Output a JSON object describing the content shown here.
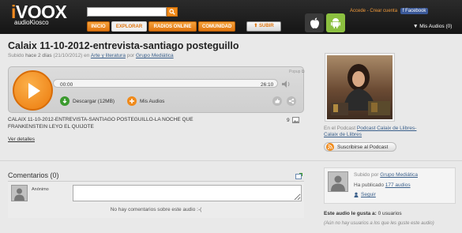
{
  "header": {
    "logo_main": "ivoox",
    "logo_sub": "audioKiosco",
    "search_placeholder": "",
    "nav": [
      "INICIO",
      "EXPLORAR",
      "RADIOS ONLINE",
      "COMUNIDAD"
    ],
    "upload_label": "SUBIR",
    "link_login": "Accede",
    "link_sep": " - ",
    "link_register": "Crear cuenta",
    "facebook_label": "Facebook",
    "mis_audios": "Mis Audios (0)",
    "accent_color": "#f08a1a"
  },
  "episode": {
    "title": "Calaix 11-10-2012-entrevista-santiago posteguillo",
    "meta_prefix": "Subido",
    "meta_when": "hace 2 días",
    "meta_date": "(21/10/2012)",
    "meta_en": "en",
    "category": "Arte y literatura",
    "meta_por": "por",
    "uploader": "Grupo Mediática",
    "description": "CALAIX 11-10-2012-ENTREVISTA-SANTIAGO POSTEGUILLO-LA NOCHE QUE FRANKENSTEIN LEYO EL QUIJOTE",
    "image_count": "9",
    "see_details": "Ver detalles"
  },
  "player": {
    "popup": "Popup",
    "time_current": "00:00",
    "time_total": "26:10",
    "progress_fraction": 0,
    "download_label": "Descargar (12MB)",
    "my_audios_label": "Mis Audios"
  },
  "podcast": {
    "in_podcast_prefix": "En el Podcast",
    "podcast_name": "Podcast Calaix de Llibres-Calaix de Llibres",
    "subscribe_label": "Suscribirse al Podcast"
  },
  "comments": {
    "title": "Comentarios (0)",
    "anon_label": "Anónimo",
    "none_text": "No hay comentarios sobre este audio :-("
  },
  "uploader_box": {
    "uploaded_by": "Subido por",
    "name": "Grupo Mediática",
    "published_prefix": "Ha publicado",
    "audio_count": "177 audios",
    "follow": "Seguir"
  },
  "likes": {
    "label": "Este audio le gusta a:",
    "count": "0 usuarios",
    "note": "(Aún no hay usuarios a los que les guste este audio)"
  }
}
